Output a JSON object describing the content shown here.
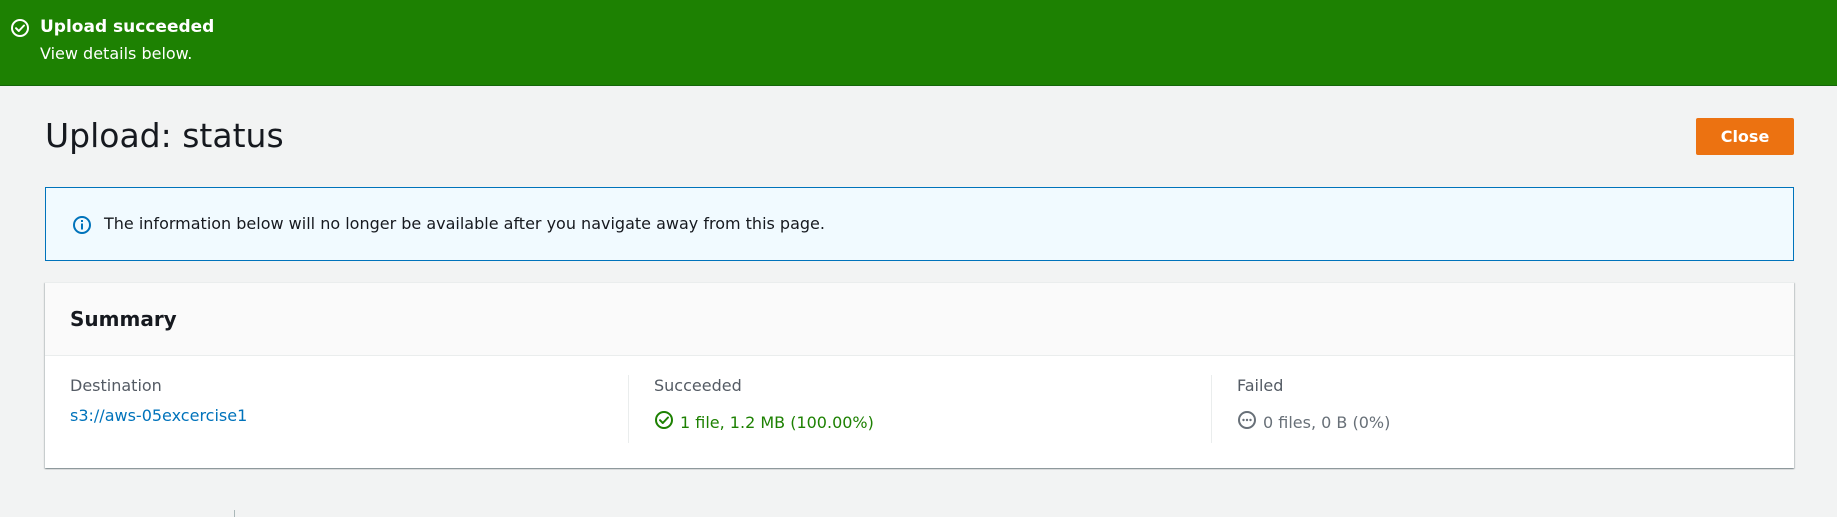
{
  "flash": {
    "icon": "check-circle-icon",
    "title": "Upload succeeded",
    "description": "View details below.",
    "color": "#1d8102"
  },
  "header": {
    "title": "Upload: status",
    "close_label": "Close",
    "close_color": "#ec7211"
  },
  "alert": {
    "icon": "info-icon",
    "text": "The information below will no longer be available after you navigate away from this page."
  },
  "summary": {
    "title": "Summary",
    "destination": {
      "label": "Destination",
      "value": "s3://aws-05excercise1"
    },
    "succeeded": {
      "label": "Succeeded",
      "icon": "check-circle-icon",
      "value": "1 file, 1.2 MB (100.00%)"
    },
    "failed": {
      "label": "Failed",
      "icon": "ellipsis-circle-icon",
      "value": "0 files, 0 B (0%)"
    }
  }
}
